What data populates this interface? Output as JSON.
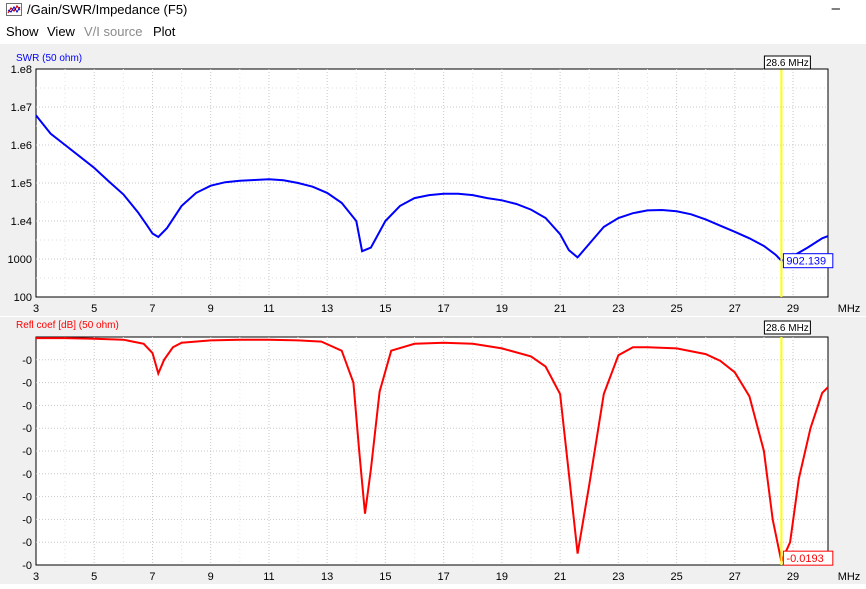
{
  "window": {
    "title": "/Gain/SWR/Impedance (F5)",
    "close_glyph": "–"
  },
  "menu": [
    {
      "label": "Show",
      "enabled": true
    },
    {
      "label": "View",
      "enabled": true
    },
    {
      "label": "V/I source",
      "enabled": false
    },
    {
      "label": "Plot",
      "enabled": true
    }
  ],
  "x_axis": {
    "ticks": [
      3,
      5,
      7,
      9,
      11,
      13,
      15,
      17,
      19,
      21,
      23,
      25,
      27,
      29
    ],
    "range": [
      3,
      30.2
    ],
    "unit": "MHz"
  },
  "cursor": {
    "freq_mhz": 28.6,
    "label": "28.6 MHz",
    "color": "#ffff00"
  },
  "chart_data": [
    {
      "type": "line",
      "title": "SWR (50 ohm)",
      "yscale": "log",
      "ylim": [
        100,
        100000000
      ],
      "ytick_labels": [
        "1.e8",
        "1.e7",
        "1.e6",
        "1.e5",
        "1.e4",
        "1000",
        "100"
      ],
      "series": [
        {
          "color": "#0000ff",
          "x": [
            3,
            3.5,
            4,
            4.5,
            5,
            5.5,
            6,
            6.5,
            6.8,
            7,
            7.2,
            7.5,
            8,
            8.5,
            9,
            9.5,
            10,
            10.5,
            11,
            11.5,
            12,
            12.5,
            13,
            13.5,
            14,
            14.2,
            14.5,
            15,
            15.5,
            16,
            16.5,
            17,
            17.5,
            18,
            18.5,
            19,
            19.5,
            20,
            20.5,
            21,
            21.3,
            21.6,
            22,
            22.5,
            23,
            23.5,
            24,
            24.5,
            25,
            25.5,
            26,
            26.5,
            27,
            27.5,
            28,
            28.4,
            28.6,
            28.8,
            29,
            29.5,
            30,
            30.2
          ],
          "y": [
            6000000,
            2000000,
            1000000,
            500000,
            250000,
            110000,
            50000,
            17000,
            8000,
            4700,
            3800,
            6500,
            25000,
            55000,
            85000,
            105000,
            115000,
            120000,
            125000,
            118000,
            100000,
            80000,
            55000,
            30000,
            10000,
            1600,
            2000,
            10000,
            25000,
            40000,
            48000,
            52000,
            52000,
            48000,
            40000,
            35000,
            28000,
            20000,
            12000,
            4500,
            1700,
            1100,
            2500,
            7000,
            12000,
            16000,
            19000,
            19500,
            18000,
            15000,
            11000,
            7500,
            5200,
            3500,
            2200,
            1300,
            900,
            1000,
            1200,
            2000,
            3500,
            4000
          ]
        }
      ],
      "annotation": {
        "x": 28.6,
        "label": "902.139"
      }
    },
    {
      "type": "line",
      "title": "Refl coef [dB] (50 ohm)",
      "ytick_labels": [
        "-0",
        "-0",
        "-0",
        "-0",
        "-0",
        "-0",
        "-0",
        "-0",
        "-0",
        "-0"
      ],
      "ylim": [
        1,
        0
      ],
      "series": [
        {
          "color": "#ff0000",
          "x": [
            3,
            4,
            5,
            6,
            6.7,
            7,
            7.2,
            7.4,
            7.7,
            8,
            9,
            10,
            11,
            12,
            12.8,
            13.5,
            13.9,
            14.1,
            14.3,
            14.5,
            14.8,
            15.2,
            16,
            17,
            18,
            19,
            20,
            20.5,
            21,
            21.3,
            21.6,
            22,
            22.5,
            23,
            23.5,
            24,
            25,
            26,
            26.5,
            27,
            27.5,
            28,
            28.3,
            28.6,
            28.9,
            29.2,
            29.6,
            30,
            30.2
          ],
          "y": [
            0.005,
            0.005,
            0.008,
            0.012,
            0.03,
            0.07,
            0.16,
            0.1,
            0.045,
            0.025,
            0.015,
            0.012,
            0.012,
            0.015,
            0.02,
            0.06,
            0.2,
            0.5,
            0.775,
            0.58,
            0.24,
            0.06,
            0.03,
            0.025,
            0.03,
            0.05,
            0.085,
            0.13,
            0.25,
            0.6,
            0.95,
            0.65,
            0.25,
            0.08,
            0.045,
            0.045,
            0.05,
            0.075,
            0.105,
            0.155,
            0.26,
            0.5,
            0.8,
            0.985,
            0.9,
            0.62,
            0.4,
            0.245,
            0.22
          ]
        }
      ],
      "annotation": {
        "x": 28.6,
        "label": "-0.0193"
      }
    }
  ]
}
